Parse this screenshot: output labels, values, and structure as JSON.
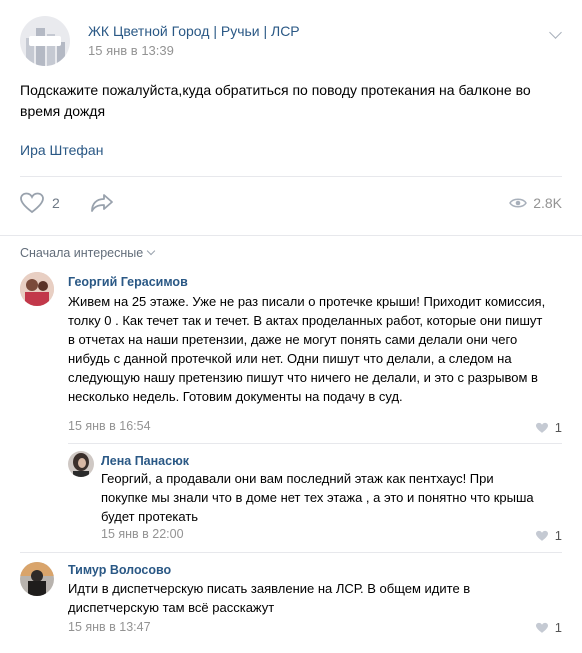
{
  "post": {
    "group_name": "ЖК Цветной Город | Ручьи | ЛСР",
    "date": "15 янв в 13:39",
    "text": "Подскажите пожалуйста,куда обратиться по поводу протекания на балконе во время дождя",
    "author": "Ира Штефан",
    "likes": "2",
    "views": "2.8K"
  },
  "comments_sort": "Сначала интересные",
  "comments": [
    {
      "name": "Георгий Герасимов",
      "text": "Живем на 25 этаже. Уже не раз писали о протечке крыши! Приходит комиссия, толку 0 . Как течет так и течет. В актах проделанных работ, которые они пишут в отчетах на наши претензии, даже не могут понять сами делали они чего нибудь с данной протечкой или нет. Одни пишут что делали, а следом на следующую нашу претензию пишут что ничего не делали, и это с разрывом в несколько недель. Готовим документы на подачу в суд.",
      "date": "15 янв в 16:54",
      "likes": "1"
    },
    {
      "name": "Лена Панасюк",
      "text": "Георгий, а продавали они вам последний этаж как пентхаус! При покупке мы знали что в доме нет тех этажа , а это и понятно что крыша будет протекать",
      "date": "15 янв в 22:00",
      "likes": "1"
    },
    {
      "name": "Тимур Волосово",
      "text": "Идти в диспетчерскую писать заявление на ЛСР. В общем идите в диспетчерскую там всё расскажут",
      "date": "15 янв в 13:47",
      "likes": "1"
    }
  ],
  "colors": {
    "link": "#2a5885",
    "muted": "#939393",
    "background": "#edeef0"
  }
}
